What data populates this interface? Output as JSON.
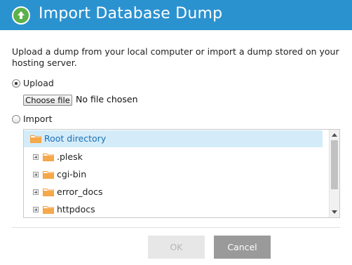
{
  "dialog": {
    "title": "Import Database Dump",
    "icon": "upload-arrow-icon",
    "accent_color": "#2b92d0",
    "icon_color": "#5bb14a"
  },
  "description": "Upload a dump from your local computer or import a dump stored on your hosting server.",
  "upload_option": {
    "label": "Upload",
    "selected": true,
    "file_button_label": "Choose file",
    "file_status": "No file chosen"
  },
  "import_option": {
    "label": "Import",
    "selected": false
  },
  "tree": {
    "items": [
      {
        "label": "Root directory",
        "selected": true,
        "icon": "folder-icon"
      },
      {
        "label": ".plesk",
        "expandable": true,
        "icon": "folder-icon"
      },
      {
        "label": "cgi-bin",
        "expandable": true,
        "icon": "folder-icon"
      },
      {
        "label": "error_docs",
        "expandable": true,
        "icon": "folder-icon"
      },
      {
        "label": "httpdocs",
        "expandable": true,
        "icon": "folder-icon"
      }
    ],
    "selected_color": "#d4ecf9",
    "folder_color": "#f6a94b"
  },
  "buttons": {
    "ok_label": "OK",
    "ok_enabled": false,
    "cancel_label": "Cancel"
  }
}
